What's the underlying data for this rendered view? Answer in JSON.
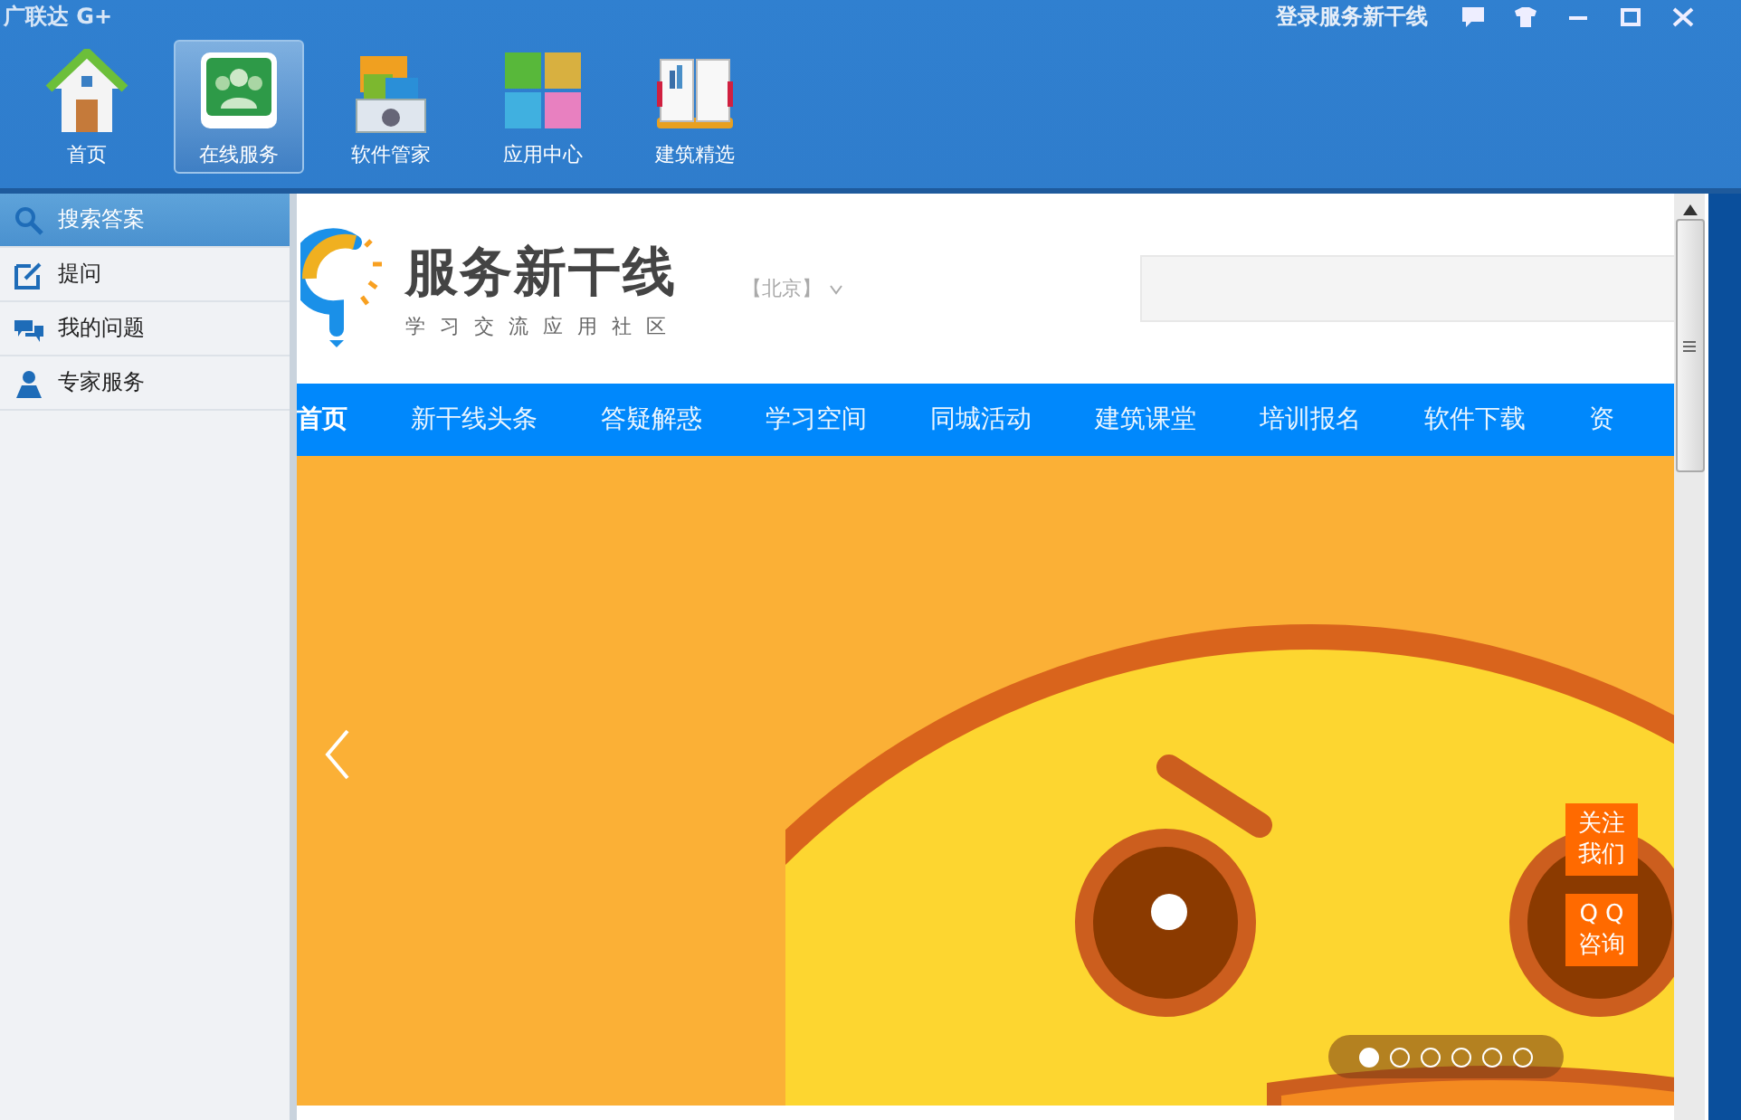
{
  "window": {
    "title": "广联达 G+",
    "login": "登录服务新干线"
  },
  "toolbar": [
    {
      "label": "首页",
      "selected": false,
      "kind": "house"
    },
    {
      "label": "在线服务",
      "selected": true,
      "kind": "people"
    },
    {
      "label": "软件管家",
      "selected": false,
      "kind": "box"
    },
    {
      "label": "应用中心",
      "selected": false,
      "kind": "tiles"
    },
    {
      "label": "建筑精选",
      "selected": false,
      "kind": "book"
    }
  ],
  "sidebar": {
    "items": [
      {
        "label": "搜索答案",
        "selected": true,
        "kind": "search"
      },
      {
        "label": "提问",
        "selected": false,
        "kind": "edit"
      },
      {
        "label": "我的问题",
        "selected": false,
        "kind": "chat"
      },
      {
        "label": "专家服务",
        "selected": false,
        "kind": "user"
      }
    ]
  },
  "site": {
    "name": "服务新干线",
    "slogan": "学习交流应用社区",
    "city": "【北京】",
    "nav": [
      {
        "label": "首页",
        "selected": true
      },
      {
        "label": "新干线头条",
        "selected": false
      },
      {
        "label": "答疑解惑",
        "selected": false
      },
      {
        "label": "学习空间",
        "selected": false
      },
      {
        "label": "同城活动",
        "selected": false
      },
      {
        "label": "建筑课堂",
        "selected": false
      },
      {
        "label": "培训报名",
        "selected": false
      },
      {
        "label": "软件下载",
        "selected": false
      },
      {
        "label": "资",
        "selected": false
      }
    ],
    "float_buttons": [
      {
        "lines": [
          "关注",
          "我们"
        ]
      },
      {
        "lines": [
          "Q Q",
          "咨询"
        ]
      }
    ],
    "carousel_dots": [
      {
        "selected": true
      },
      {
        "selected": false
      },
      {
        "selected": false
      },
      {
        "selected": false
      },
      {
        "selected": false
      },
      {
        "selected": false
      }
    ]
  }
}
